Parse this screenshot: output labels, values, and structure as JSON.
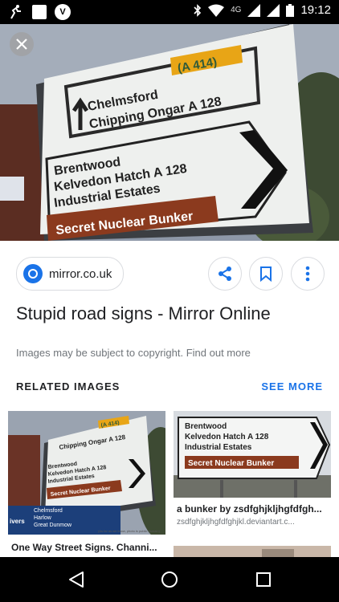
{
  "status_bar": {
    "network": "4G",
    "time": "19:12"
  },
  "hero_sign": {
    "top_road": "(A 414)",
    "top_line1": "Chelmsford",
    "top_line2": "Chipping Ongar A 128",
    "mid_line1": "Brentwood",
    "mid_line2": "Kelvedon Hatch A 128",
    "mid_line3": "Industrial Estates",
    "bottom_line": "Secret Nuclear Bunker"
  },
  "source": {
    "domain": "mirror.co.uk"
  },
  "actions": {
    "share": "share-icon",
    "save": "bookmark-icon",
    "more": "more-vert-icon"
  },
  "result": {
    "title": "Stupid road signs - Mirror Online",
    "copyright_note": "Images may be subject to copyright. Find out more"
  },
  "related": {
    "heading": "RELATED IMAGES",
    "see_more": "SEE MORE",
    "cards": [
      {
        "title": "One Way Street Signs. Channi...",
        "sign_road": "(A 414)",
        "sign_top": "Chipping Ongar A 128",
        "sign_l1": "Brentwood",
        "sign_l2": "Kelvedon Hatch A 128",
        "sign_l3": "Industrial Estates",
        "sign_bottom": "Secret Nuclear Bunker",
        "lower_l1": "Chelmsford",
        "lower_l2": "Harlow",
        "lower_l3": "Great Dunmow",
        "lower_frag": "ivers",
        "credit": "(As far as we know, photo is public domain)"
      },
      {
        "title": "a bunker by zsdfghjkljhgfdfgh...",
        "source": "zsdfghjkljhgfdfghjkl.deviantart.c...",
        "sign_l1": "Brentwood",
        "sign_l2": "Kelvedon Hatch A 128",
        "sign_l3": "Industrial Estates",
        "sign_bottom": "Secret Nuclear Bunker"
      }
    ]
  },
  "colors": {
    "accent": "#1a73e8",
    "sign_brown": "#8b3a1e",
    "sign_green": "#2f5a3a",
    "sign_yellow": "#e8a516"
  }
}
